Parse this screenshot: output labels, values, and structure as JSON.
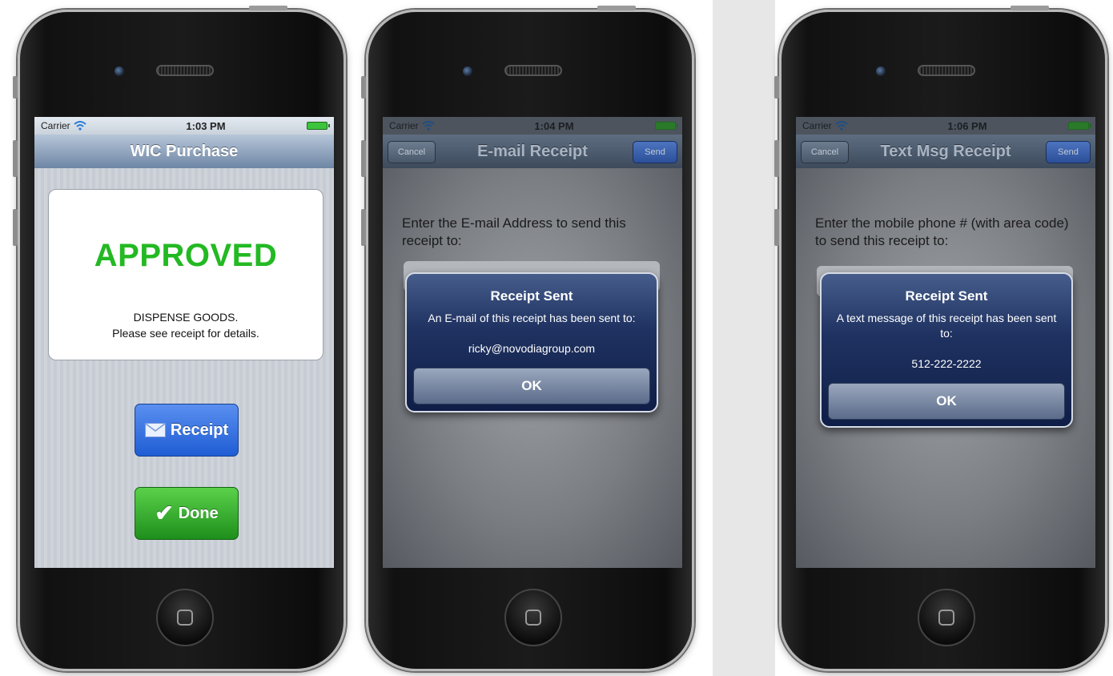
{
  "phones": [
    {
      "status": {
        "carrier": "Carrier",
        "time": "1:03 PM"
      },
      "nav": {
        "title": "WIC Purchase"
      },
      "card": {
        "headline": "APPROVED",
        "line1": "DISPENSE GOODS.",
        "line2": "Please see receipt for details."
      },
      "buttons": {
        "receipt": "Receipt",
        "done": "Done"
      }
    },
    {
      "status": {
        "carrier": "Carrier",
        "time": "1:04 PM"
      },
      "nav": {
        "cancel": "Cancel",
        "title": "E-mail Receipt",
        "send": "Send"
      },
      "prompt": "Enter the E-mail Address to send this receipt to:",
      "alert": {
        "title": "Receipt Sent",
        "message": "An E-mail of this receipt has been sent to:",
        "recipient": "ricky@novodiagroup.com",
        "ok": "OK"
      }
    },
    {
      "status": {
        "carrier": "Carrier",
        "time": "1:06 PM"
      },
      "nav": {
        "cancel": "Cancel",
        "title": "Text Msg Receipt",
        "send": "Send"
      },
      "prompt": "Enter the mobile phone # (with area code) to send this receipt to:",
      "alert": {
        "title": "Receipt Sent",
        "message": "A text message of this receipt has been sent to:",
        "recipient": "512-222-2222",
        "ok": "OK"
      }
    }
  ],
  "colors": {
    "approved_green": "#23b923",
    "nav_blue": "#6e86a5",
    "alert_navy": "#1f3261"
  }
}
